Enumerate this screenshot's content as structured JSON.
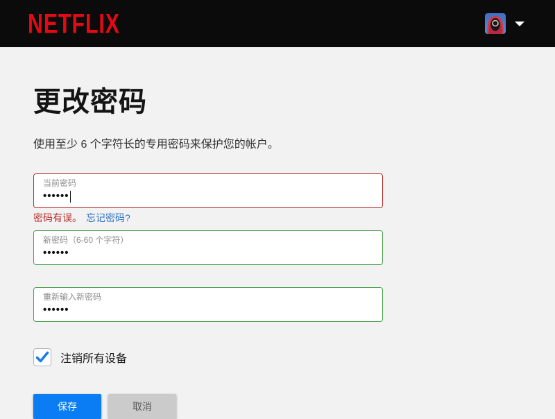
{
  "header": {
    "logo": "NETFLIX"
  },
  "page": {
    "title": "更改密码",
    "subtitle": "使用至少 6 个字符长的专用密码来保护您的帐户。"
  },
  "form": {
    "current": {
      "label": "当前密码",
      "value": "••••••"
    },
    "error_text": "密码有误。",
    "forgot_link": "忘记密码?",
    "new": {
      "label": "新密码（6-60 个字符）",
      "value": "••••••"
    },
    "confirm": {
      "label": "重新输入新密码",
      "value": "••••••"
    },
    "signout_label": "注销所有设备",
    "signout_checked": true,
    "save_label": "保存",
    "cancel_label": "取消"
  },
  "colors": {
    "header_bg": "#0b0b0b",
    "brand_red": "#e50914",
    "page_bg": "#f2f2f2",
    "error_red": "#b92d2b",
    "valid_green": "#4aa04e",
    "link_blue": "#2d6fc5",
    "primary_blue": "#0a7df4",
    "check_blue": "#1a7ce8",
    "label_gray": "#8c8c8c"
  }
}
